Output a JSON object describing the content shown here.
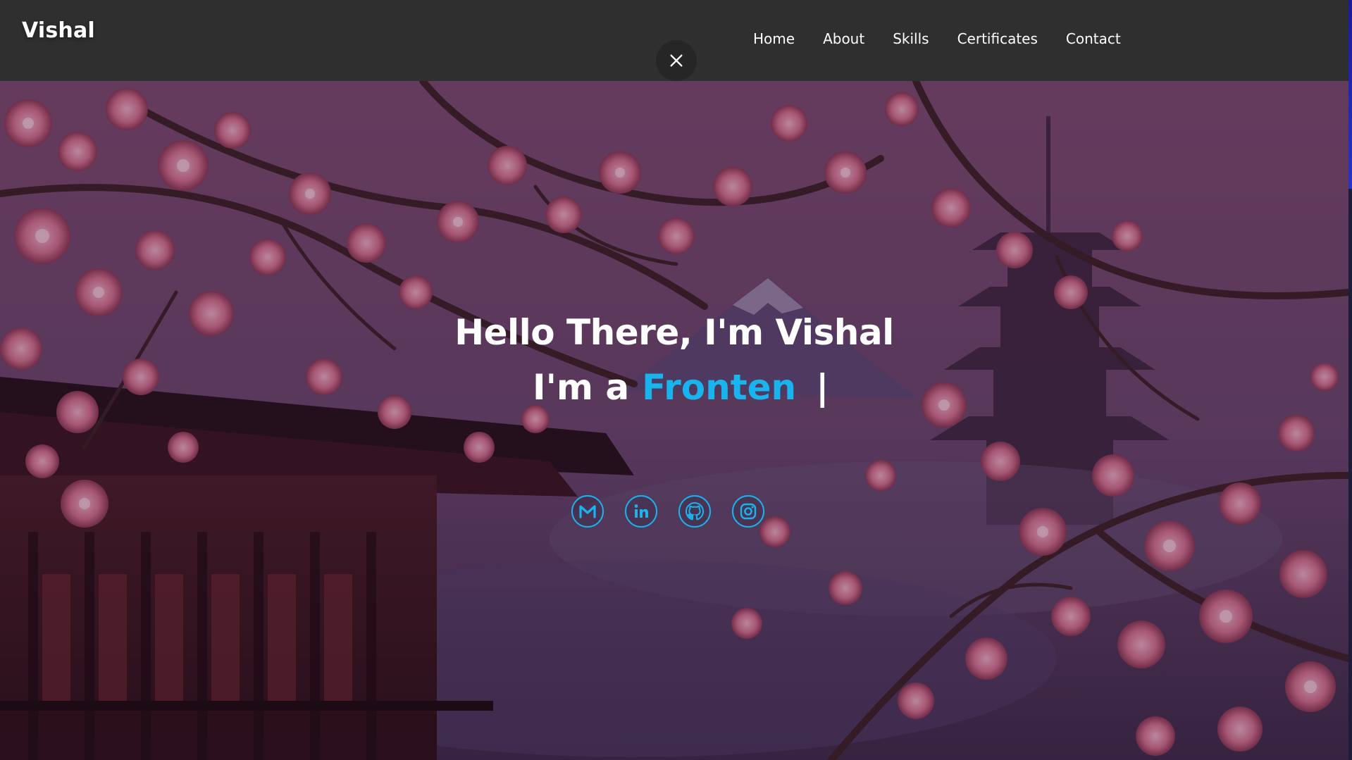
{
  "navbar": {
    "brand": "Vishal",
    "links": [
      "Home",
      "About",
      "Skills",
      "Certificates",
      "Contact"
    ]
  },
  "hero": {
    "greeting": "Hello There, I'm Vishal",
    "role_prefix": "I'm a",
    "role_typed": "Fronten",
    "cursor": "|"
  },
  "socials": [
    {
      "icon": "gmail-icon"
    },
    {
      "icon": "linkedin-icon"
    },
    {
      "icon": "github-icon"
    },
    {
      "icon": "instagram-icon"
    }
  ],
  "colors": {
    "accent": "#19b4ee",
    "navbar_bg": "#2f2f2f",
    "text": "#ffffff"
  }
}
